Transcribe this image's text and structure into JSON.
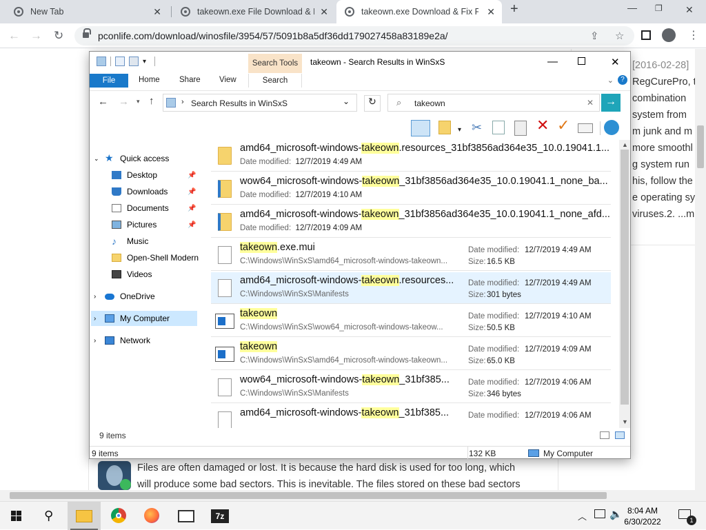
{
  "browser": {
    "tabs": [
      {
        "title": "New Tab",
        "active": false
      },
      {
        "title": "takeown.exe File Download & Fix",
        "active": false
      },
      {
        "title": "takeown.exe Download & Fix For",
        "active": true
      }
    ],
    "url": "pconlife.com/download/winosfile/3954/57/5091b8a5df36dd179027458a83189e2a/"
  },
  "webpage": {
    "side_lines": [
      "[2016-02-28]",
      "RegCurePro, t",
      "combination",
      "system from",
      "m junk and m",
      "more smoothl",
      "g system run",
      "his, follow the",
      "e operating sy",
      "viruses.2. ...m"
    ],
    "bottom_lines": [
      "Files are often damaged or lost. It is because the hard disk is used for too long, which",
      "will produce some bad sectors. This is inevitable. The files stored on these bad sectors"
    ]
  },
  "explorer": {
    "title": "takeown - Search Results in WinSxS",
    "context_tab": "Search Tools",
    "ribbon_tabs": {
      "file": "File",
      "home": "Home",
      "share": "Share",
      "view": "View",
      "search": "Search"
    },
    "address": "Search Results in WinSxS",
    "search_value": "takeown",
    "nav": {
      "quick_access": "Quick access",
      "desktop": "Desktop",
      "downloads": "Downloads",
      "documents": "Documents",
      "pictures": "Pictures",
      "music": "Music",
      "openshell": "Open-Shell Modern",
      "videos": "Videos",
      "onedrive": "OneDrive",
      "mycomputer": "My Computer",
      "network": "Network"
    },
    "labels": {
      "date_modified": "Date modified:",
      "size": "Size:"
    },
    "rows": [
      {
        "pre": "amd64_microsoft-windows-",
        "hl": "takeown",
        "post": ".resources_31bf3856ad364e35_10.0.19041.1...",
        "date": "12/7/2019 4:49 AM",
        "icon": "folder-icon"
      },
      {
        "pre": "wow64_microsoft-windows-",
        "hl": "takeown",
        "post": "_31bf3856ad364e35_10.0.19041.1_none_ba...",
        "date": "12/7/2019 4:10 AM",
        "icon": "folder-icon"
      },
      {
        "pre": "amd64_microsoft-windows-",
        "hl": "takeown",
        "post": "_31bf3856ad364e35_10.0.19041.1_none_afd...",
        "date": "12/7/2019 4:09 AM",
        "icon": "folder-icon"
      },
      {
        "pre": "",
        "hl": "takeown",
        "post": ".exe.mui",
        "path": "C:\\Windows\\WinSxS\\amd64_microsoft-windows-takeown...",
        "date": "12/7/2019 4:49 AM",
        "size": "16.5 KB",
        "icon": "file-icon"
      },
      {
        "pre": "amd64_microsoft-windows-",
        "hl": "takeown",
        "post": ".resources...",
        "path": "C:\\Windows\\WinSxS\\Manifests",
        "date": "12/7/2019 4:49 AM",
        "size": "301 bytes",
        "icon": "file-icon"
      },
      {
        "pre": "",
        "hl": "takeown",
        "post": "",
        "path": "C:\\Windows\\WinSxS\\wow64_microsoft-windows-takeow...",
        "date": "12/7/2019 4:10 AM",
        "size": "50.5 KB",
        "icon": "exe-icon"
      },
      {
        "pre": "",
        "hl": "takeown",
        "post": "",
        "path": "C:\\Windows\\WinSxS\\amd64_microsoft-windows-takeown...",
        "date": "12/7/2019 4:09 AM",
        "size": "65.0 KB",
        "icon": "exe-icon"
      },
      {
        "pre": "wow64_microsoft-windows-",
        "hl": "takeown",
        "post": "_31bf385...",
        "path": "C:\\Windows\\WinSxS\\Manifests",
        "date": "12/7/2019 4:06 AM",
        "size": "346 bytes",
        "icon": "file-icon"
      },
      {
        "pre": "amd64_microsoft-windows-",
        "hl": "takeown",
        "post": "_31bf385...",
        "date": "12/7/2019 4:06 AM",
        "icon": "file-icon"
      }
    ],
    "items_count": "9 items",
    "status": {
      "items": "9 items",
      "size": "132 KB",
      "location": "My Computer"
    }
  },
  "taskbar": {
    "time": "8:04 AM",
    "date": "6/30/2022",
    "notifications": "1"
  }
}
